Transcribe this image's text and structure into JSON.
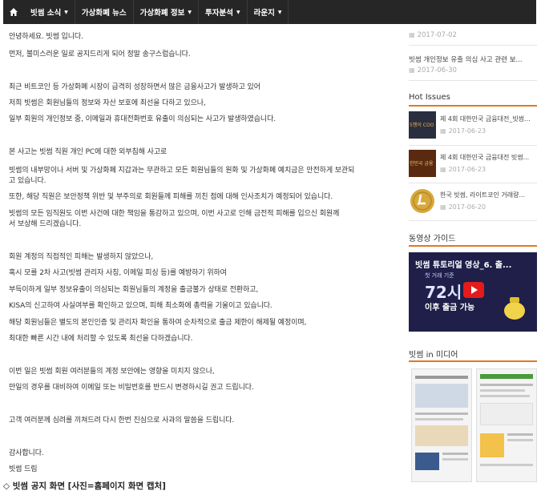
{
  "nav": {
    "home_icon": "home-icon",
    "items": [
      {
        "label": "빗썸 소식",
        "caret": "▼"
      },
      {
        "label": "가상화폐 뉴스",
        "caret": ""
      },
      {
        "label": "가상화폐 정보",
        "caret": "▼"
      },
      {
        "label": "투자분석",
        "caret": "▼"
      },
      {
        "label": "라운지",
        "caret": "▼"
      }
    ]
  },
  "article": {
    "paragraphs": [
      "안녕하세요. 빗썸 입니다.",
      "먼저, 불미스러운 일로 공지드리게 되어 정말 송구스럽습니다.",
      "최근 비트코인 등 가상화폐 시장이 급격히 성장하면서 많은 금융사고가 발생하고 있어",
      "저희 빗썸은 회원님들의 정보와 자산 보호에 최선을 다하고 있으나,",
      "일부 회원의 개인정보 중, 이메일과 휴대전화번호 유출이 의심되는 사고가 발생하였습니다.",
      "본 사고는 빗썸 직원 개인 PC에 대한 외부침해 사고로",
      "빗썸의 내부망이나 서버 및 가상화폐 지갑과는 무관하고 모든 회원님들의 원화 및 가상화폐 예치금은 안전하게 보관되",
      "고 있습니다.",
      "또한, 해당 직원은 보안정책 위반 및 부주의로 회원들께 피해를 끼친 점에 대해 인사조치가 예정되어 있습니다.",
      "빗썸의 모든 임직원도 이번 사건에 대한 책임을 통감하고 있으며, 이번 사고로 인해 금전적 피해를 입으신 회원께",
      "서 보상해 드리겠습니다.",
      "회원 계정의 직접적인 피해는 발생하지 않았으나,",
      "혹시 모를 2차 사고(빗썸 관리자 사칭, 이메일 피싱 등)를 예방하기 위하여",
      "부득이하게 일부 정보유출이 의심되는 회원님들의 계정을 출금불가 상태로 전환하고,",
      "KISA의 신고하여 사실여부를 확인하고 있으며, 피해 최소화에 총력을 기울이고 있습니다.",
      "해당 회원님들은 별도의 본인인증 및 관리자 확인을 통하여 순차적으로 출금 제한이 해제될 예정이며,",
      "최대한 빠른 시간 내에 처리할 수 있도록 최선을 다하겠습니다.",
      "이번 일은 빗썸 회원 여러분들의 계정 보안에는 영향을 미치지 않으나,",
      "만일의 경우를 대비하여 이메일 또는 비밀번호를 반드시 변경하시길 권고 드립니다.",
      "고객 여러분께 심려를 끼쳐드려 다시 한번 진심으로 사과의 말씀을 드립니다.",
      "감사합니다.",
      "빗썸 드림"
    ]
  },
  "sidebar": {
    "recent": [
      {
        "title": "",
        "date": "2017-07-02"
      },
      {
        "title": "빗썸 개인정보 유출 의심 사고 관련 보...",
        "date": "2017-06-30"
      }
    ],
    "hot_title": "Hot Issues",
    "hot": [
      {
        "thumb_text": "5행이 COO",
        "title": "제 4회 대한민국 금융대전_빗썸...",
        "date": "2017-06-23"
      },
      {
        "thumb_text": "한민국 금융",
        "title": "제 4회 대한민국 금융대전 빗썸...",
        "date": "2017-06-23"
      },
      {
        "thumb_text": "",
        "title": "한국 빗썸, 라이트코인 거래량...",
        "date": "2017-06-20"
      }
    ],
    "video_section_title": "동영상 가이드",
    "video": {
      "title": "빗썸 튜토리얼 영상_6. 출...",
      "subtitle": "첫 거래 기준",
      "big_text": "72시",
      "bottom_text": "이후 출금 가능"
    },
    "media_section_title": "빗썸 in 미디어"
  },
  "caption": "◇ 빗썸 공지 화면 [사진=홈페이지 화면 캡처]",
  "colors": {
    "nav_bg": "#262626",
    "accent": "#e07a1f"
  }
}
